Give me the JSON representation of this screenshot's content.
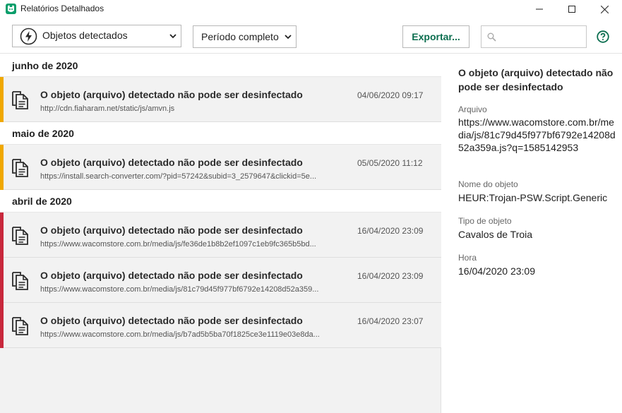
{
  "window": {
    "title": "Relatórios Detalhados",
    "accent": "#0b6e4f"
  },
  "toolbar": {
    "objects_filter": "Objetos detectados",
    "period_filter": "Período completo",
    "export_label": "Exportar...",
    "search_placeholder": "",
    "search_value": ""
  },
  "list": {
    "groups": [
      {
        "label": "junho de 2020",
        "items": [
          {
            "title": "O objeto (arquivo) detectado não pode ser desinfectado",
            "url": "http://cdn.fiaharam.net/static/js/amvn.js",
            "date": "04/06/2020 09:17",
            "severity_color": "#f0a800"
          }
        ]
      },
      {
        "label": "maio de 2020",
        "items": [
          {
            "title": "O objeto (arquivo) detectado não pode ser desinfectado",
            "url": "https://install.search-converter.com/?pid=57242&subid=3_2579647&clickid=5e...",
            "date": "05/05/2020 11:12",
            "severity_color": "#f0a800"
          }
        ]
      },
      {
        "label": "abril de 2020",
        "items": [
          {
            "title": "O objeto (arquivo) detectado não pode ser desinfectado",
            "url": "https://www.wacomstore.com.br/media/js/fe36de1b8b2ef1097c1eb9fc365b5bd...",
            "date": "16/04/2020 23:09",
            "severity_color": "#c8283c"
          },
          {
            "title": "O objeto (arquivo) detectado não pode ser desinfectado",
            "url": "https://www.wacomstore.com.br/media/js/81c79d45f977bf6792e14208d52a359...",
            "date": "16/04/2020 23:09",
            "severity_color": "#c8283c"
          },
          {
            "title": "O objeto (arquivo) detectado não pode ser desinfectado",
            "url": "https://www.wacomstore.com.br/media/js/b7ad5b5ba70f1825ce3e1119e03e8da...",
            "date": "16/04/2020 23:07",
            "severity_color": "#c8283c"
          }
        ]
      }
    ]
  },
  "detail": {
    "title": "O objeto (arquivo) detectado não pode ser desinfectado",
    "file_label": "Arquivo",
    "file_value": "https://www.wacomstore.com.br/media/js/81c79d45f977bf6792e14208d52a359a.js?q=1585142953",
    "name_label": "Nome do objeto",
    "name_value": "HEUR:Trojan-PSW.Script.Generic",
    "type_label": "Tipo de objeto",
    "type_value": "Cavalos de Troia",
    "time_label": "Hora",
    "time_value": "16/04/2020 23:09"
  }
}
